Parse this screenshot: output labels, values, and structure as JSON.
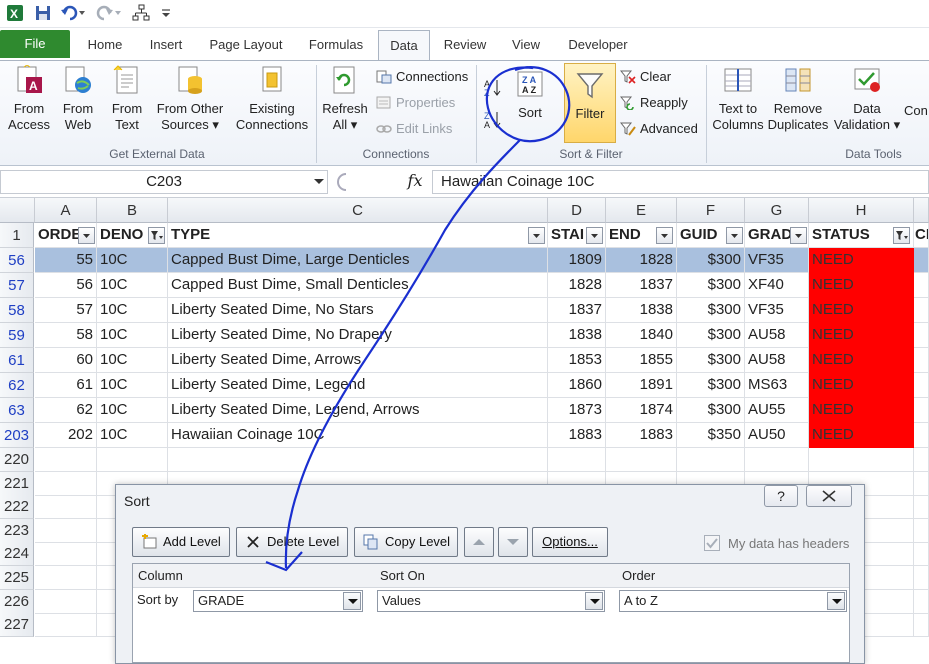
{
  "tabs": [
    "File",
    "Home",
    "Insert",
    "Page Layout",
    "Formulas",
    "Data",
    "Review",
    "View",
    "Developer"
  ],
  "ribbon": {
    "get_external": {
      "from_access": [
        "From",
        "Access"
      ],
      "from_web": [
        "From",
        "Web"
      ],
      "from_text": [
        "From",
        "Text"
      ],
      "from_other": [
        "From Other",
        "Sources ▾"
      ],
      "existing": [
        "Existing",
        "Connections"
      ],
      "label": "Get External Data"
    },
    "connections": {
      "refresh": [
        "Refresh",
        "All ▾"
      ],
      "connections": "Connections",
      "properties": "Properties",
      "edit_links": "Edit Links",
      "label": "Connections"
    },
    "sort_filter": {
      "sort": "Sort",
      "filter": "Filter",
      "clear": "Clear",
      "reapply": "Reapply",
      "advanced": "Advanced",
      "label": "Sort & Filter"
    },
    "data_tools": {
      "text_to_columns": [
        "Text to",
        "Columns"
      ],
      "remove_duplicates": [
        "Remove",
        "Duplicates"
      ],
      "data_validation": [
        "Data",
        "Validation ▾"
      ],
      "consolidate": "Con",
      "label": "Data Tools"
    }
  },
  "formula_bar": {
    "name_box": "C203",
    "fx": "fx",
    "formula": "Hawaiian Coinage 10C"
  },
  "columns": [
    "A",
    "B",
    "C",
    "D",
    "E",
    "F",
    "G",
    "H"
  ],
  "header_row": {
    "num": "1",
    "cells": [
      "ORDE",
      "DENO",
      "TYPE",
      "STAI",
      "END",
      "GUID",
      "GRAD",
      "STATUS",
      "CI"
    ]
  },
  "rows": [
    {
      "num": "56",
      "cells": [
        "55",
        "10C",
        "Capped Bust Dime, Large Denticles",
        "1809",
        "1828",
        "$300",
        "VF35",
        "NEED"
      ]
    },
    {
      "num": "57",
      "cells": [
        "56",
        "10C",
        "Capped Bust Dime, Small Denticles",
        "1828",
        "1837",
        "$300",
        "XF40",
        "NEED"
      ]
    },
    {
      "num": "58",
      "cells": [
        "57",
        "10C",
        "Liberty Seated Dime, No Stars",
        "1837",
        "1838",
        "$300",
        "VF35",
        "NEED"
      ]
    },
    {
      "num": "59",
      "cells": [
        "58",
        "10C",
        "Liberty Seated Dime, No Drapery",
        "1838",
        "1840",
        "$300",
        "AU58",
        "NEED"
      ]
    },
    {
      "num": "61",
      "cells": [
        "60",
        "10C",
        "Liberty Seated Dime, Arrows",
        "1853",
        "1855",
        "$300",
        "AU58",
        "NEED"
      ]
    },
    {
      "num": "62",
      "cells": [
        "61",
        "10C",
        "Liberty Seated Dime, Legend",
        "1860",
        "1891",
        "$300",
        "MS63",
        "NEED"
      ]
    },
    {
      "num": "63",
      "cells": [
        "62",
        "10C",
        "Liberty Seated Dime, Legend, Arrows",
        "1873",
        "1874",
        "$300",
        "AU55",
        "NEED"
      ]
    },
    {
      "num": "203",
      "cells": [
        "202",
        "10C",
        "Hawaiian Coinage 10C",
        "1883",
        "1883",
        "$350",
        "AU50",
        "NEED"
      ]
    }
  ],
  "empty_rows": [
    "220",
    "221",
    "222",
    "223",
    "224",
    "225",
    "226",
    "227"
  ],
  "dialog": {
    "title": "Sort",
    "help": "?",
    "add_level": "Add Level",
    "delete_level": "Delete Level",
    "copy_level": "Copy Level",
    "options": "Options...",
    "headers_label": "My data has headers",
    "col_header": "Column",
    "sorton_header": "Sort On",
    "order_header": "Order",
    "sort_by": "Sort by",
    "column_value": "GRADE",
    "sorton_value": "Values",
    "order_value": "A to Z"
  },
  "colors": {
    "need": "#ff0000",
    "selected_row": "#a9c0de",
    "file_tab": "#2f8a2f",
    "annotation": "#1a2fd0"
  }
}
